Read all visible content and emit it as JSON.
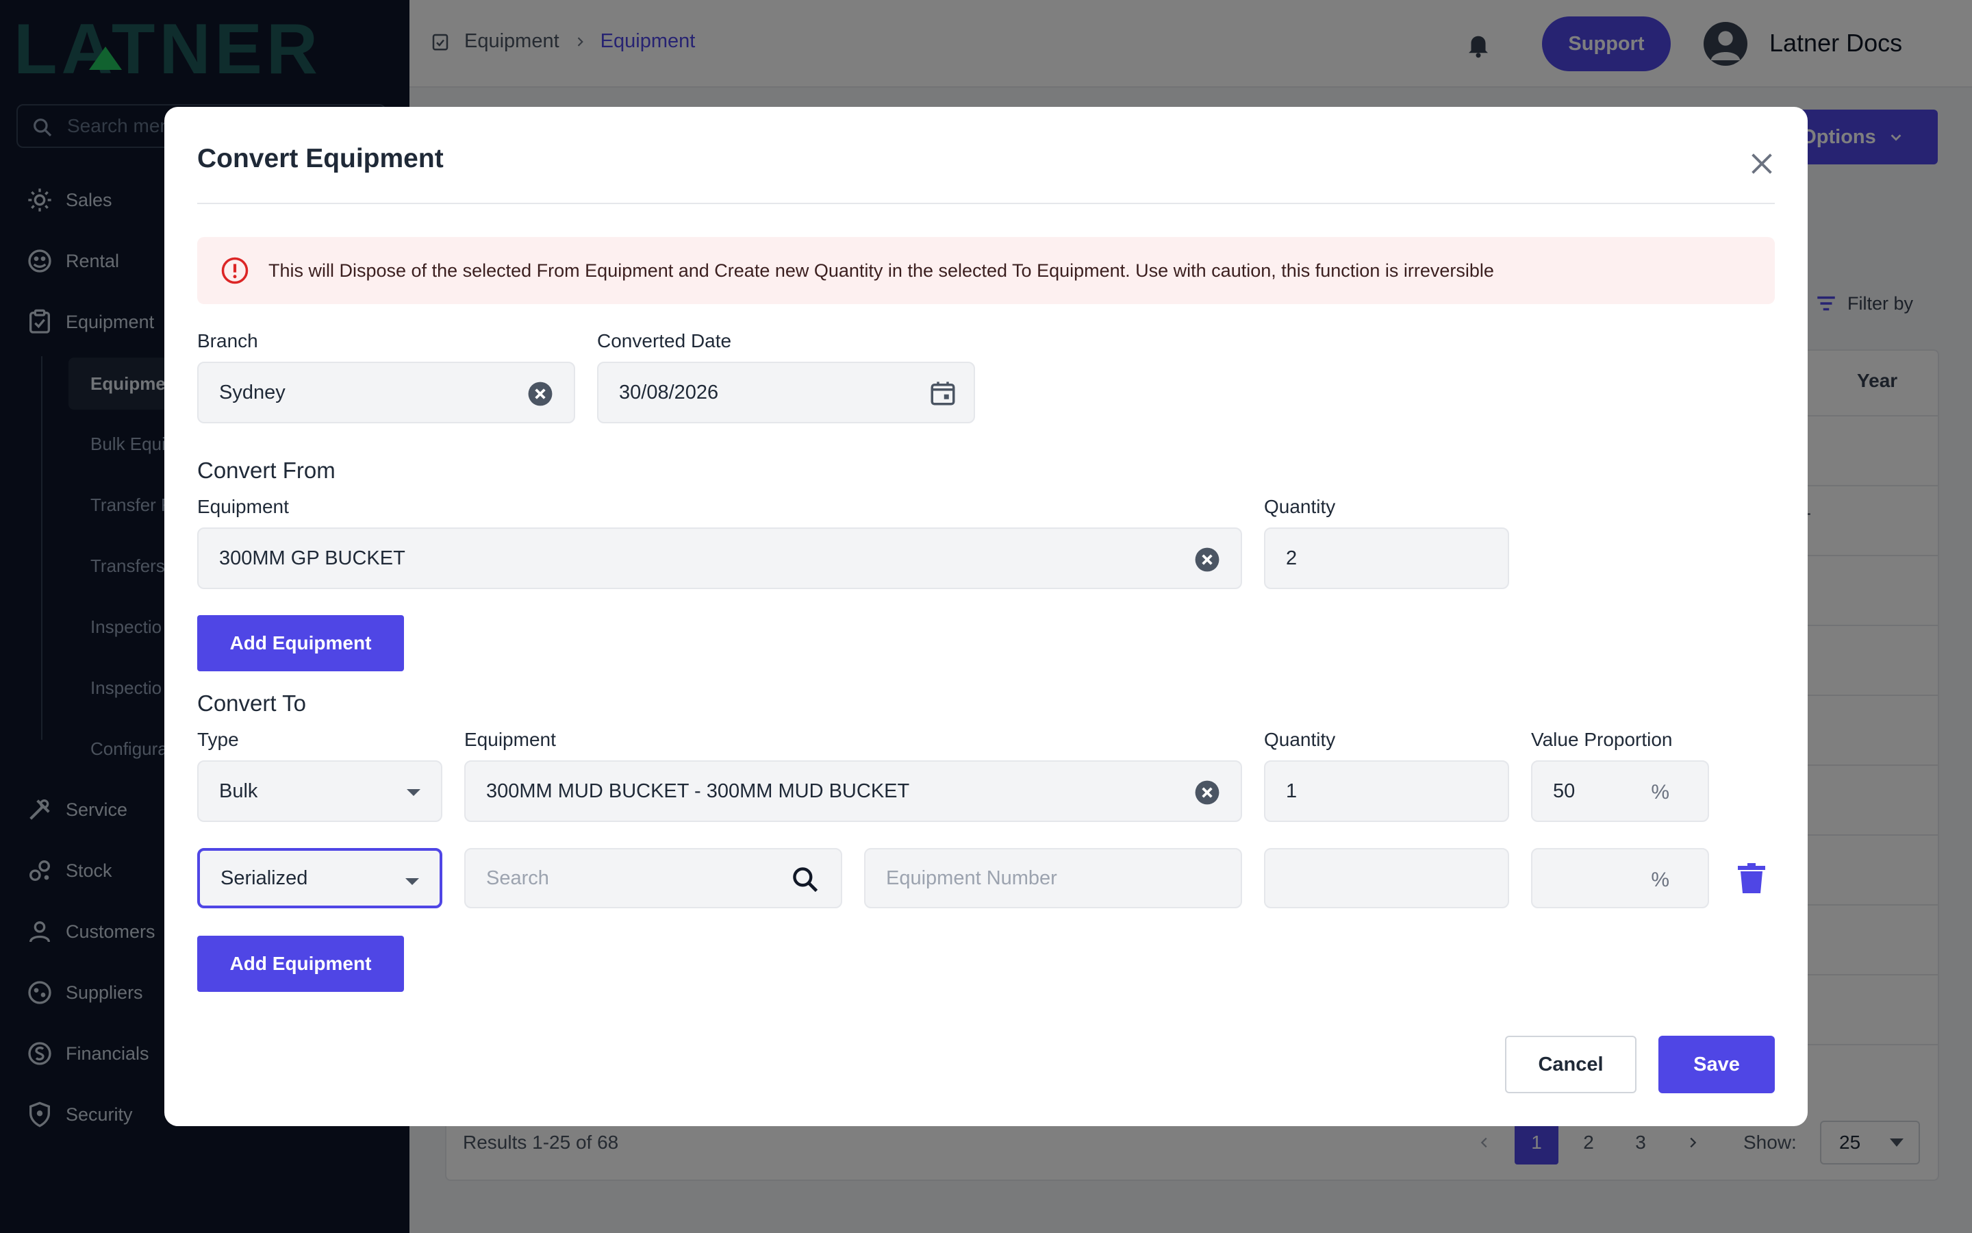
{
  "brand": {
    "logo": "LATNER"
  },
  "sidebar": {
    "search_placeholder": "Search menu",
    "items": [
      {
        "label": "Sales",
        "icon": "sales-icon"
      },
      {
        "label": "Rental",
        "icon": "rental-icon"
      },
      {
        "label": "Equipment",
        "icon": "equipment-icon"
      },
      {
        "label": "Service",
        "icon": "service-icon"
      },
      {
        "label": "Stock",
        "icon": "stock-icon"
      },
      {
        "label": "Customers",
        "icon": "customers-icon"
      },
      {
        "label": "Suppliers",
        "icon": "suppliers-icon"
      },
      {
        "label": "Financials",
        "icon": "financials-icon"
      },
      {
        "label": "Security",
        "icon": "security-icon"
      }
    ],
    "sub_items": [
      "Equipme",
      "Bulk Equi",
      "Transfer F",
      "Transfers",
      "Inspectio",
      "Inspectio",
      "Configura"
    ]
  },
  "topbar": {
    "breadcrumb": [
      "Equipment",
      "Equipment"
    ],
    "support_label": "Support",
    "user_name": "Latner Docs"
  },
  "background": {
    "options_label": "Options",
    "filter_label": "Filter by",
    "year_header": "Year",
    "row_fragment": "ET",
    "results_text": "Results 1-25 of 68",
    "pages": [
      "1",
      "2",
      "3"
    ],
    "current_page": "1",
    "show_label": "Show:",
    "show_value": "25"
  },
  "modal": {
    "title": "Convert Equipment",
    "alert": "This will Dispose of the selected From Equipment and Create new Quantity in the selected To Equipment. Use with caution, this function is irreversible",
    "branch_label": "Branch",
    "branch_value": "Sydney",
    "date_label": "Converted Date",
    "date_value": "30/08/2026",
    "convert_from": {
      "heading": "Convert From",
      "equipment_label": "Equipment",
      "equipment_value": "300MM GP BUCKET",
      "quantity_label": "Quantity",
      "quantity_value": "2",
      "add_label": "Add Equipment"
    },
    "convert_to": {
      "heading": "Convert To",
      "type_label": "Type",
      "equipment_label": "Equipment",
      "quantity_label": "Quantity",
      "proportion_label": "Value Proportion",
      "row1": {
        "type": "Bulk",
        "equipment": "300MM MUD BUCKET - 300MM MUD BUCKET",
        "quantity": "1",
        "proportion": "50",
        "unit": "%"
      },
      "row2": {
        "type": "Serialized",
        "search_placeholder": "Search",
        "number_placeholder": "Equipment Number",
        "quantity": "",
        "proportion": "",
        "unit": "%"
      },
      "add_label": "Add Equipment"
    },
    "cancel_label": "Cancel",
    "save_label": "Save"
  },
  "colors": {
    "accent": "#4f46e5",
    "sidebar": "#0f172a",
    "alert_bg": "#fdf0f0",
    "alert_icon": "#dc2626"
  }
}
